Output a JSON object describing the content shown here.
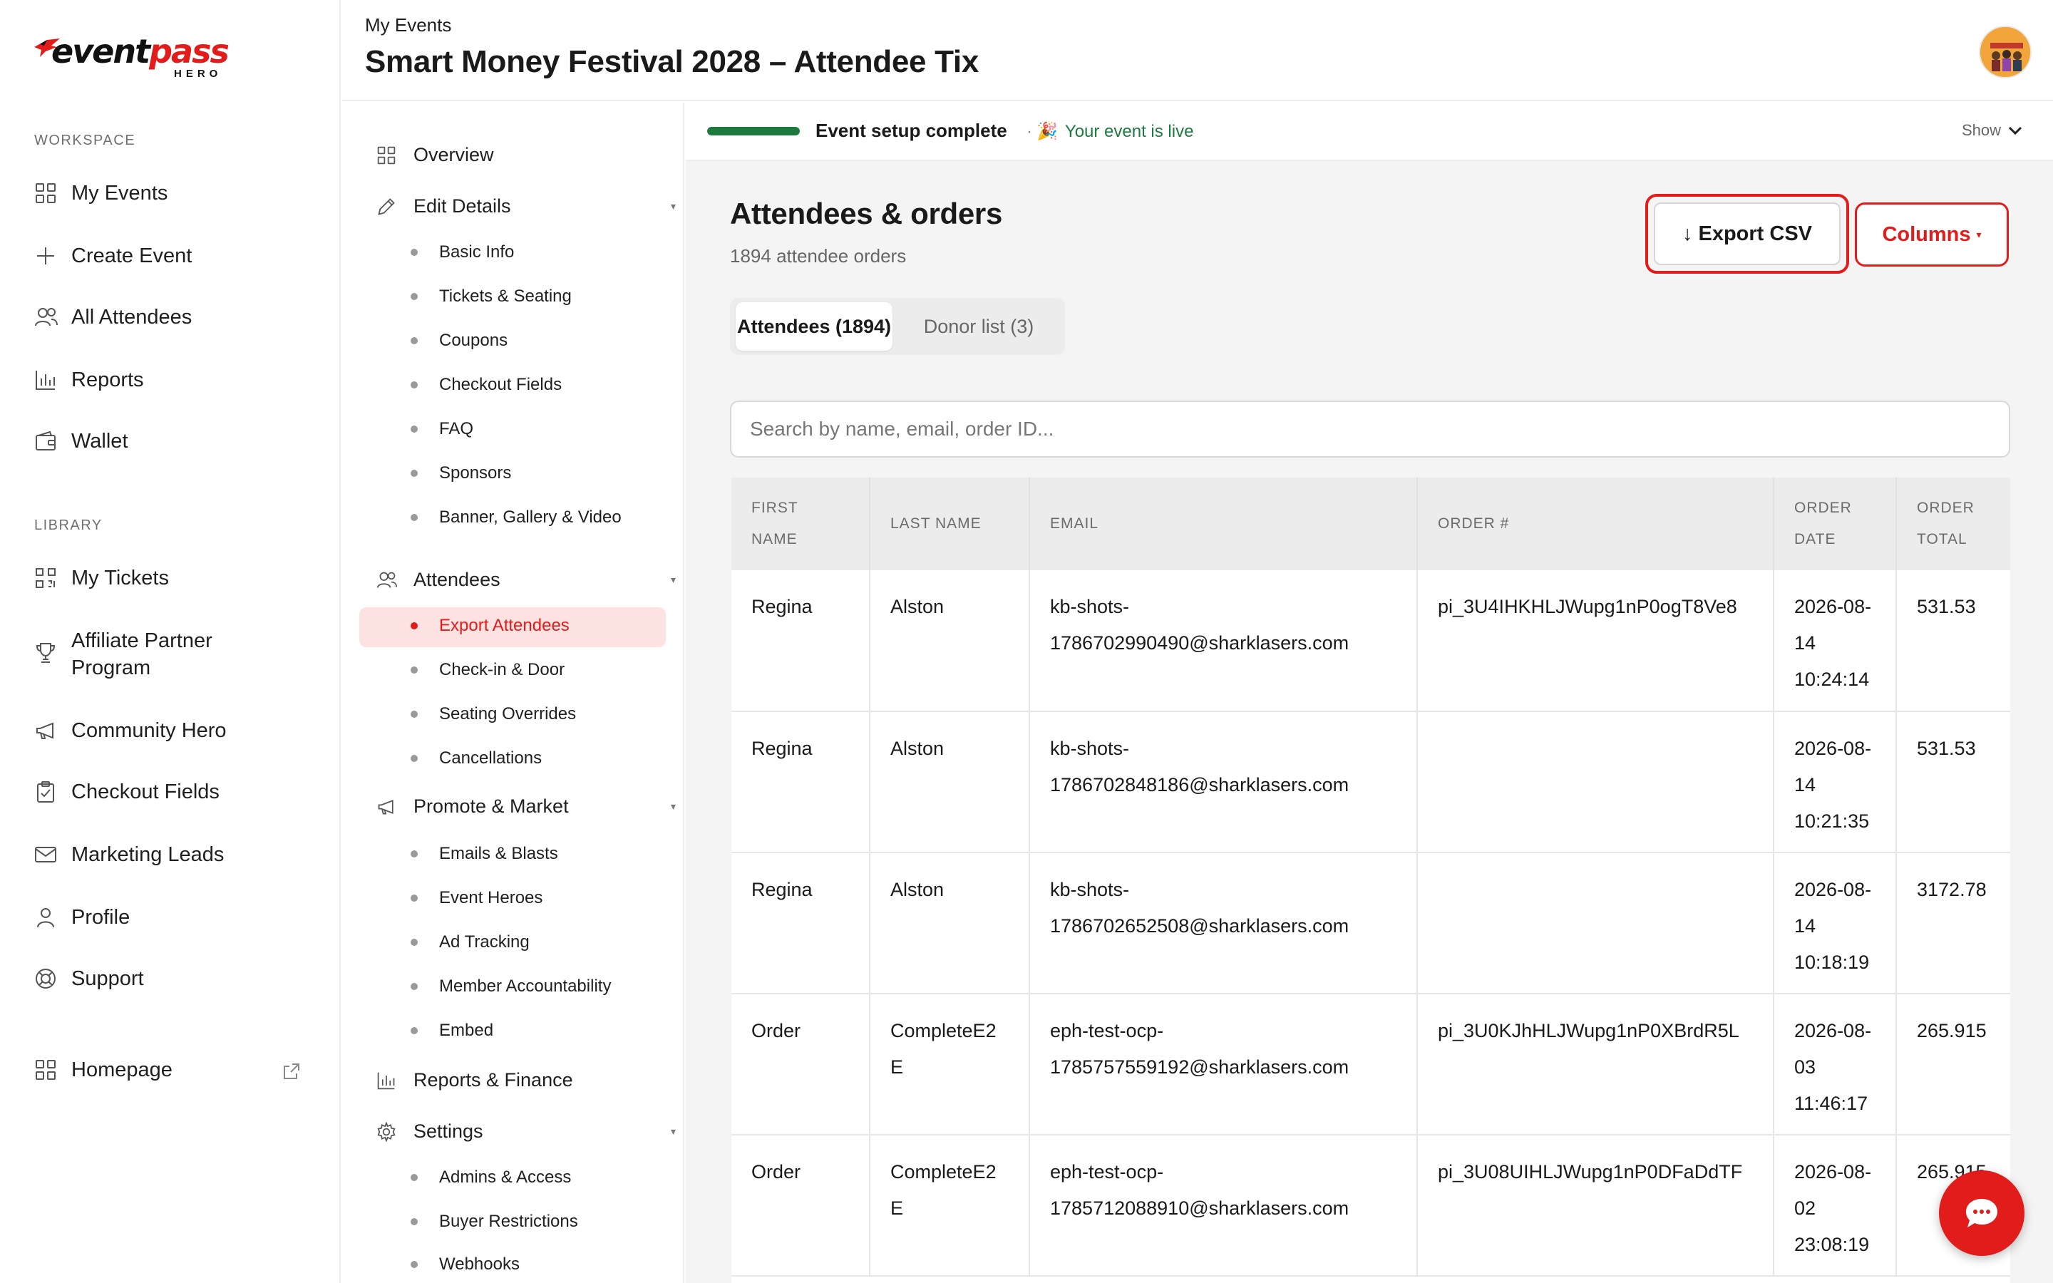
{
  "brand": {
    "logo_text_1": "event",
    "logo_text_2": "pass",
    "logo_sub": "HERO",
    "accent": "#e21b1b"
  },
  "sidebar": {
    "workspace_label": "WORKSPACE",
    "workspace_items": [
      {
        "label": "My Events",
        "icon": "grid-icon"
      },
      {
        "label": "Create Event",
        "icon": "plus-icon"
      },
      {
        "label": "All Attendees",
        "icon": "users-icon"
      },
      {
        "label": "Reports",
        "icon": "bar-chart-icon"
      },
      {
        "label": "Wallet",
        "icon": "wallet-icon"
      }
    ],
    "library_label": "LIBRARY",
    "library_items": [
      {
        "label": "My Tickets",
        "icon": "qr-icon"
      },
      {
        "label": "Affiliate Partner Program",
        "icon": "trophy-icon"
      },
      {
        "label": "Community Hero",
        "icon": "megaphone-icon"
      },
      {
        "label": "Checkout Fields",
        "icon": "clipboard-icon"
      },
      {
        "label": "Marketing Leads",
        "icon": "mail-icon"
      },
      {
        "label": "Profile",
        "icon": "user-icon"
      },
      {
        "label": "Support",
        "icon": "lifebuoy-icon"
      }
    ],
    "homepage": {
      "label": "Homepage",
      "icon": "grid-icon"
    }
  },
  "header": {
    "breadcrumb": "My Events",
    "title": "Smart Money Festival 2028 – Attendee Tix"
  },
  "event_nav": {
    "overview": "Overview",
    "edit_details": "Edit Details",
    "edit_details_items": [
      "Basic Info",
      "Tickets & Seating",
      "Coupons",
      "Checkout Fields",
      "FAQ",
      "Sponsors",
      "Banner, Gallery & Video"
    ],
    "attendees": "Attendees",
    "attendees_items": [
      "Export Attendees",
      "Check-in & Door",
      "Seating Overrides",
      "Cancellations"
    ],
    "promote": "Promote & Market",
    "promote_items": [
      "Emails & Blasts",
      "Event Heroes",
      "Ad Tracking",
      "Member Accountability",
      "Embed"
    ],
    "reports": "Reports & Finance",
    "settings": "Settings",
    "settings_items": [
      "Admins & Access",
      "Buyer Restrictions",
      "Webhooks"
    ]
  },
  "status": {
    "setup_text": "Event setup complete",
    "separator": "·",
    "live_emoji": "🎉",
    "live_text": "Your event is live",
    "show_label": "Show",
    "progress": 1.0,
    "progress_color": "#1d7a3f"
  },
  "main": {
    "heading": "Attendees & orders",
    "subheading": "1894 attendee orders",
    "export_arrow": "↓",
    "export_label": "Export CSV",
    "columns_label": "Columns",
    "columns_caret": "▾",
    "tabs": [
      "Attendees (1894)",
      "Donor list (3)"
    ],
    "search_placeholder": "Search by name, email, order ID..."
  },
  "table": {
    "columns": [
      "FIRST NAME",
      "LAST NAME",
      "EMAIL",
      "ORDER #",
      "ORDER DATE",
      "ORDER TOTAL"
    ],
    "rows": [
      {
        "first": "Regina",
        "last": "Alston",
        "email": "kb-shots-1786702990490@sharklasers.com",
        "order": "pi_3U4IHKHLJWupg1nP0ogT8Ve8",
        "date": "2026-08-14 10:24:14",
        "total": "531.53"
      },
      {
        "first": "Regina",
        "last": "Alston",
        "email": "kb-shots-1786702848186@sharklasers.com",
        "order": "",
        "date": "2026-08-14 10:21:35",
        "total": "531.53"
      },
      {
        "first": "Regina",
        "last": "Alston",
        "email": "kb-shots-1786702652508@sharklasers.com",
        "order": "",
        "date": "2026-08-14 10:18:19",
        "total": "3172.78"
      },
      {
        "first": "Order",
        "last": "CompleteE2E",
        "email": "eph-test-ocp-1785757559192@sharklasers.com",
        "order": "pi_3U0KJhHLJWupg1nP0XBrdR5L",
        "date": "2026-08-03 11:46:17",
        "total": "265.915"
      },
      {
        "first": "Order",
        "last": "CompleteE2E",
        "email": "eph-test-ocp-1785712088910@sharklasers.com",
        "order": "pi_3U08UIHLJWupg1nP0DFaDdTF",
        "date": "2026-08-02 23:08:19",
        "total": "265.915"
      }
    ]
  }
}
